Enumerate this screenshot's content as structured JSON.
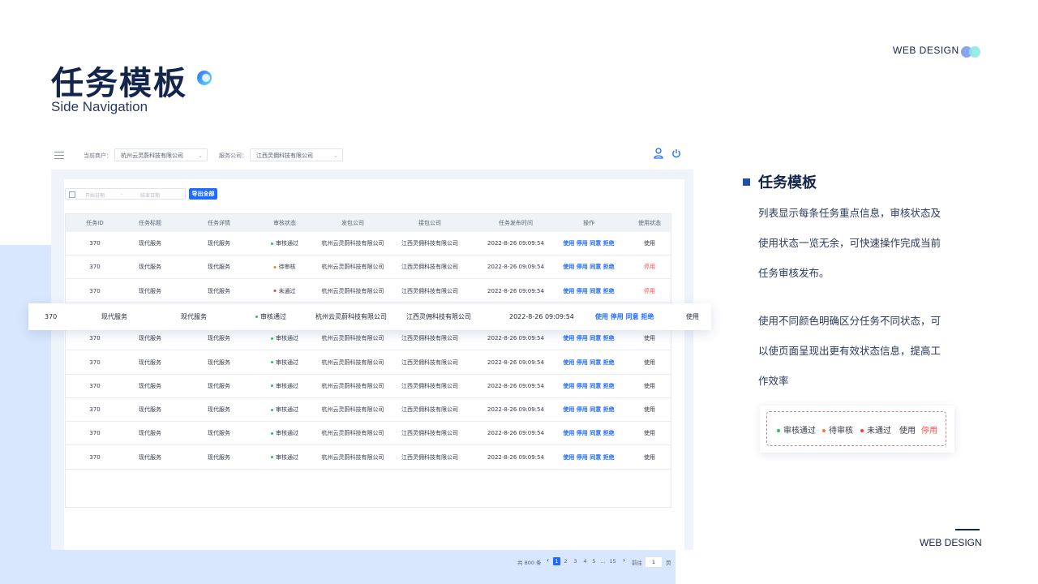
{
  "header": {
    "title": "任务模板",
    "subtitle": "Side Navigation",
    "brand_top": "WEB DESIGN",
    "brand_bottom": "WEB DESIGN"
  },
  "colors": {
    "primary": "#1f6bff",
    "approved": "#22c55e",
    "pending": "#ff7a1a",
    "rejected": "#ff3b30",
    "stopped": "#ff4d4f"
  },
  "topbar": {
    "merchant_label": "当前商户：",
    "merchant_value": "杭州云灵蔚科技有限公司",
    "service_label": "服务公司：",
    "service_value": "江西灵佣科技有限公司",
    "icons": [
      "menu-icon",
      "user-icon",
      "power-icon"
    ]
  },
  "filter": {
    "start_placeholder": "开始日期",
    "separator": "-",
    "end_placeholder": "结束日期",
    "export_label": "导出全部"
  },
  "table": {
    "columns": [
      "任务ID",
      "任务标题",
      "任务详情",
      "审核状态",
      "发包公司",
      "接包公司",
      "任务发布时间",
      "操作",
      "使用状态"
    ],
    "ops_text": "使用 停用 同意 拒绝",
    "rows": [
      {
        "id": "370",
        "title": "现代服务",
        "detail": "现代服务",
        "status": "审核通过",
        "status_key": "approved",
        "sender": "杭州云灵蔚科技有限公司",
        "receiver": "江西灵佣科技有限公司",
        "time": "2022-8-26 09:09:54",
        "usage": "使用",
        "usage_key": "use"
      },
      {
        "id": "370",
        "title": "现代服务",
        "detail": "现代服务",
        "status": "待审核",
        "status_key": "pending",
        "sender": "杭州云灵蔚科技有限公司",
        "receiver": "江西灵佣科技有限公司",
        "time": "2022-8-26 09:09:54",
        "usage": "停用",
        "usage_key": "stop"
      },
      {
        "id": "370",
        "title": "现代服务",
        "detail": "现代服务",
        "status": "未通过",
        "status_key": "rejected",
        "sender": "杭州云灵蔚科技有限公司",
        "receiver": "江西灵佣科技有限公司",
        "time": "2022-8-26 09:09:54",
        "usage": "停用",
        "usage_key": "stop"
      },
      {
        "id": "370",
        "title": "现代服务",
        "detail": "现代服务",
        "status": "审核通过",
        "status_key": "approved",
        "sender": "杭州云灵蔚科技有限公司",
        "receiver": "江西灵佣科技有限公司",
        "time": "2022-8-26 09:09:54",
        "usage": "使用",
        "usage_key": "use"
      },
      {
        "id": "370",
        "title": "现代服务",
        "detail": "现代服务",
        "status": "审核通过",
        "status_key": "approved",
        "sender": "杭州云灵蔚科技有限公司",
        "receiver": "江西灵佣科技有限公司",
        "time": "2022-8-26 09:09:54",
        "usage": "使用",
        "usage_key": "use"
      },
      {
        "id": "370",
        "title": "现代服务",
        "detail": "现代服务",
        "status": "审核通过",
        "status_key": "approved",
        "sender": "杭州云灵蔚科技有限公司",
        "receiver": "江西灵佣科技有限公司",
        "time": "2022-8-26 09:09:54",
        "usage": "使用",
        "usage_key": "use"
      },
      {
        "id": "370",
        "title": "现代服务",
        "detail": "现代服务",
        "status": "审核通过",
        "status_key": "approved",
        "sender": "杭州云灵蔚科技有限公司",
        "receiver": "江西灵佣科技有限公司",
        "time": "2022-8-26 09:09:54",
        "usage": "使用",
        "usage_key": "use"
      },
      {
        "id": "370",
        "title": "现代服务",
        "detail": "现代服务",
        "status": "审核通过",
        "status_key": "approved",
        "sender": "杭州云灵蔚科技有限公司",
        "receiver": "江西灵佣科技有限公司",
        "time": "2022-8-26 09:09:54",
        "usage": "使用",
        "usage_key": "use"
      },
      {
        "id": "370",
        "title": "现代服务",
        "detail": "现代服务",
        "status": "审核通过",
        "status_key": "approved",
        "sender": "杭州云灵蔚科技有限公司",
        "receiver": "江西灵佣科技有限公司",
        "time": "2022-8-26 09:09:54",
        "usage": "使用",
        "usage_key": "use"
      },
      {
        "id": "370",
        "title": "现代服务",
        "detail": "现代服务",
        "status": "审核通过",
        "status_key": "approved",
        "sender": "杭州云灵蔚科技有限公司",
        "receiver": "江西灵佣科技有限公司",
        "time": "2022-8-26 09:09:54",
        "usage": "使用",
        "usage_key": "use"
      }
    ]
  },
  "highlight_row": {
    "id": "370",
    "title": "现代服务",
    "detail": "现代服务",
    "status": "审核通过",
    "status_key": "approved",
    "sender": "杭州云灵蔚科技有限公司",
    "receiver": "江西灵佣科技有限公司",
    "time": "2022-8-26 09:09:54",
    "ops": "使用 停用 同意 拒绝",
    "usage": "使用"
  },
  "pagination": {
    "total": "共 800 条",
    "prev": "‹",
    "pages": [
      "1",
      "2",
      "3",
      "4",
      "5",
      "...",
      "15"
    ],
    "current": "1",
    "next": "›",
    "goto_label": "前往",
    "goto_value": "1",
    "page_unit": "页"
  },
  "description": {
    "title": "任务模板",
    "lines1": [
      "列表显示每条任务重点信息，审核状态及",
      "使用状态一览无余，可快速操作完成当前",
      "任务审核发布。"
    ],
    "lines2": [
      "使用不同颜色明确区分任务不同状态，可",
      "以使页面呈现出更有效状态信息，提高工",
      "作效率"
    ]
  },
  "legend": {
    "approved": "审核通过",
    "pending": "待审核",
    "rejected": "未通过",
    "use": "使用",
    "stop": "停用"
  }
}
